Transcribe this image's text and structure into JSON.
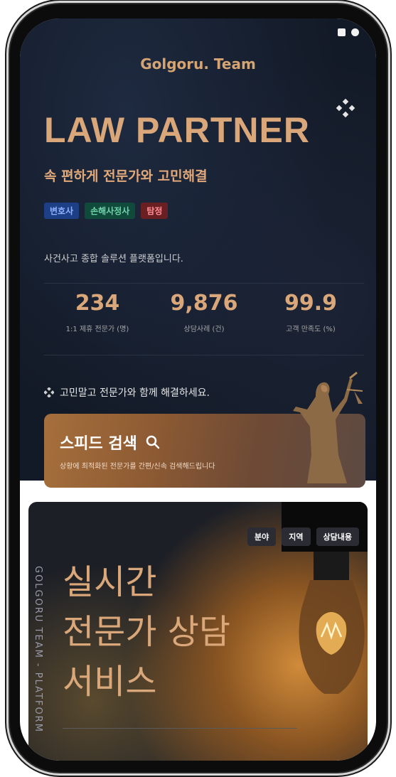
{
  "status_icons": [
    "square-icon",
    "dot-icon"
  ],
  "brand": {
    "team": "Golgoru. Team",
    "title": "LAW PARTNER"
  },
  "hero": {
    "subtitle": "속 편하게 전문가와 고민해결",
    "tags": [
      {
        "label": "변호사",
        "color": "#1d3f86"
      },
      {
        "label": "손해사정사",
        "color": "#0f4a3a"
      },
      {
        "label": "탐정",
        "color": "#6a1f23"
      }
    ],
    "description": "사건사고 종합 솔루션 플랫폼입니다."
  },
  "stats": [
    {
      "value": "234",
      "label": "1:1 제휴 전문가 (명)"
    },
    {
      "value": "9,876",
      "label": "상담사례 (건)"
    },
    {
      "value": "99.9",
      "label": "고객 만족도 (%)"
    }
  ],
  "hint": "고민말고 전문가와 함께 해결하세요.",
  "speed_search": {
    "title": "스피드 검색",
    "description": "상황에 최적화된 전문가를 간편/신속 검색해드립니다"
  },
  "live": {
    "tabs": [
      "분야",
      "지역",
      "상담내용"
    ],
    "vertical_text": "GOLGORU TEAM - PLATFORM",
    "lines": [
      "실시간",
      "전문가 상담",
      "서비스"
    ]
  },
  "colors": {
    "accent": "#d9a779",
    "background": "#131a27"
  }
}
